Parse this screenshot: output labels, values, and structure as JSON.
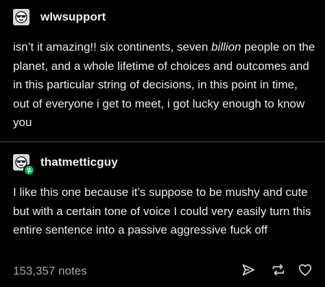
{
  "posts": [
    {
      "username": "wlwsupport",
      "avatar_icon": "sunglasses-face-icon",
      "body": {
        "before": "isn’t it amazing!! six continents, seven ",
        "emphasis": "billion",
        "after": " people on the planet, and a whole lifetime of choices and outcomes and in this particular string of decisions, in this point in time, out of everyone i get to meet, i got lucky enough to know you"
      }
    },
    {
      "username": "thatmetticguy",
      "avatar_icon": "sunglasses-face-icon",
      "badge_icon": "reblog-icon",
      "body": {
        "text": "I like this one because it’s suppose to be mushy and cute but with a certain tone of voice I could very easily turn this entire sentence into a passive aggressive fuck off"
      }
    }
  ],
  "footer": {
    "notes": "153,357 notes",
    "actions": [
      {
        "name": "share",
        "icon": "send-icon"
      },
      {
        "name": "reblog",
        "icon": "reblog-icon"
      },
      {
        "name": "like",
        "icon": "heart-icon"
      }
    ]
  },
  "colors": {
    "background": "#000000",
    "text": "#ececec",
    "muted": "#a8a8a8",
    "reblog_badge": "#00b85c",
    "avatar": "#d9d9d9"
  }
}
